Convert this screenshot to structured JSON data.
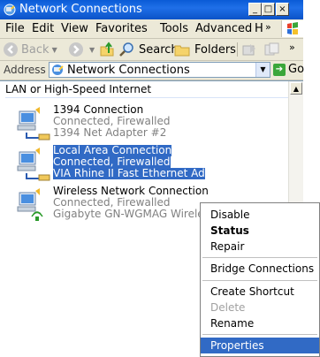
{
  "window": {
    "title": "Network Connections",
    "minimize": "_",
    "maximize": "□",
    "close": "×"
  },
  "menu": {
    "items": [
      "File",
      "Edit",
      "View",
      "Favorites",
      "Tools",
      "Advanced",
      "H"
    ],
    "overflow": "»"
  },
  "toolbar": {
    "back": "Back",
    "search": "Search",
    "folders": "Folders",
    "overflow": "»"
  },
  "address": {
    "label": "Address",
    "value": "Network Connections",
    "go": "Go"
  },
  "content": {
    "group_header": "LAN or High-Speed Internet",
    "connections": [
      {
        "name": "1394 Connection",
        "status": "Connected, Firewalled",
        "device": "1394 Net Adapter #2",
        "selected": false
      },
      {
        "name": "Local Area Connection",
        "status": "Connected, Firewalled",
        "device": "VIA Rhine II Fast Ethernet Ad",
        "selected": true
      },
      {
        "name": "Wireless Network Connection",
        "status": "Connected, Firewalled",
        "device": "Gigabyte GN-WGMAG Wireless",
        "selected": false
      }
    ]
  },
  "context_menu": {
    "disable": "Disable",
    "status": "Status",
    "repair": "Repair",
    "bridge": "Bridge Connections",
    "create_shortcut": "Create Shortcut",
    "delete": "Delete",
    "rename": "Rename",
    "properties": "Properties"
  },
  "colors": {
    "selection": "#316ac5",
    "titlebar": "#0a5bd6",
    "window_bg": "#ece9d8"
  }
}
